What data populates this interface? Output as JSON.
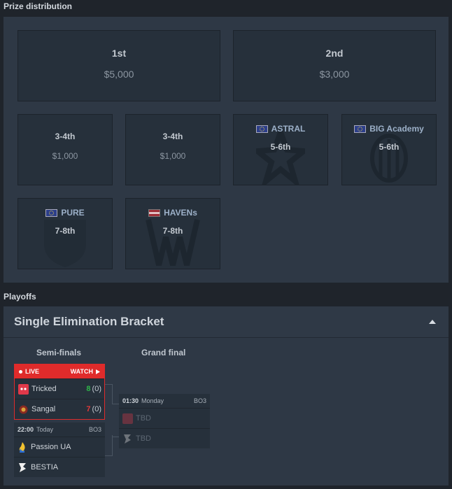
{
  "prize": {
    "title": "Prize distribution",
    "first": {
      "place": "1st",
      "amount": "$5,000"
    },
    "second": {
      "place": "2nd",
      "amount": "$3,000"
    },
    "third_a": {
      "place": "3-4th",
      "amount": "$1,000"
    },
    "third_b": {
      "place": "3-4th",
      "amount": "$1,000"
    },
    "astral": {
      "team": "ASTRAL",
      "place": "5-6th",
      "flag": "EU"
    },
    "big_academy": {
      "team": "BIG Academy",
      "place": "5-6th",
      "flag": "EU"
    },
    "pure": {
      "team": "PURE",
      "place": "7-8th",
      "flag": "EU"
    },
    "havens": {
      "team": "HAVENs",
      "place": "7-8th",
      "flag": "LV"
    }
  },
  "playoffs": {
    "title": "Playoffs",
    "bracket_title": "Single Elimination Bracket",
    "rounds": {
      "semi": "Semi-finals",
      "final": "Grand final"
    },
    "semi1": {
      "live": "LIVE",
      "watch": "WATCH",
      "team1": {
        "name": "Tricked",
        "score": "8",
        "series": "(0)"
      },
      "team2": {
        "name": "Sangal",
        "score": "7",
        "series": "(0)"
      }
    },
    "semi2": {
      "time": "22:00",
      "day": "Today",
      "format": "BO3",
      "team1": {
        "name": "Passion UA"
      },
      "team2": {
        "name": "BESTIA"
      }
    },
    "final": {
      "time": "01:30",
      "day": "Monday",
      "format": "BO3",
      "team1": {
        "name": "TBD"
      },
      "team2": {
        "name": "TBD"
      }
    }
  },
  "colors": {
    "live": "#e02b2b",
    "win": "#2fb34a",
    "lose": "#e03a3a",
    "panel": "#2e3845",
    "card": "#26303b"
  }
}
